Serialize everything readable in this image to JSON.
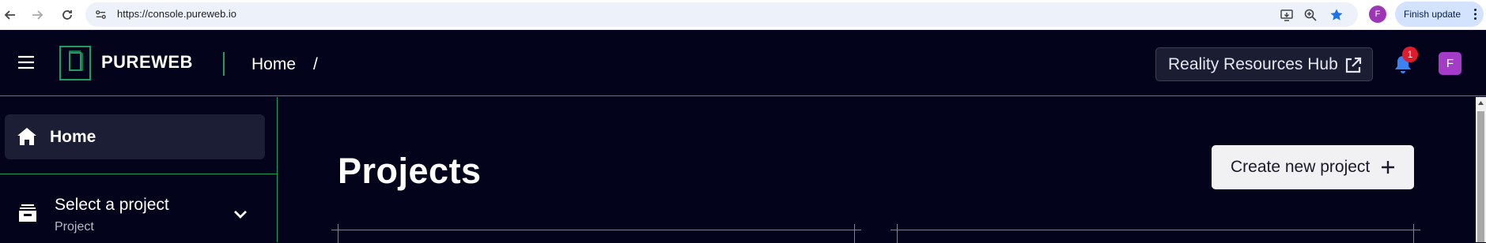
{
  "browser": {
    "url": "https://console.pureweb.io",
    "profile_initial": "F",
    "finish_update_label": "Finish update"
  },
  "header": {
    "logo_text": "PUREWEB",
    "breadcrumb_home": "Home",
    "breadcrumb_separator": "/",
    "hub_button_label": "Reality Resources Hub",
    "notification_count": "1",
    "user_initial": "F"
  },
  "sidebar": {
    "home_label": "Home",
    "project_select_title": "Select a project",
    "project_select_subtitle": "Project"
  },
  "main": {
    "title": "Projects",
    "create_button_label": "Create new project"
  },
  "colors": {
    "background": "#03031c",
    "accent_green": "#1e9e5c",
    "badge_red": "#e01b2c",
    "avatar_purple": "#a43cc8"
  }
}
